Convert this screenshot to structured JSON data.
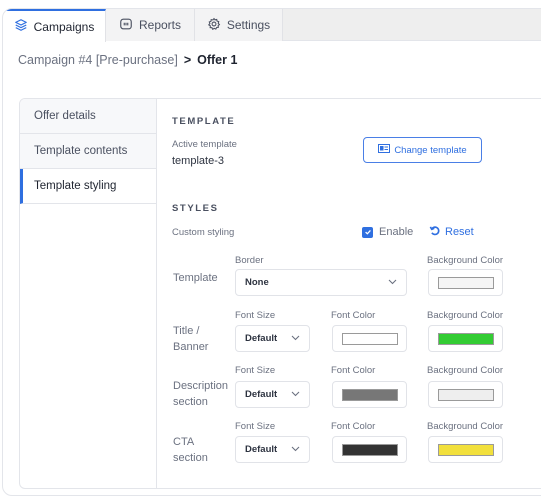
{
  "tabs": [
    {
      "label": "Campaigns",
      "icon": "layers-icon",
      "active": true
    },
    {
      "label": "Reports",
      "icon": "reports-icon",
      "active": false
    },
    {
      "label": "Settings",
      "icon": "gear-icon",
      "active": false
    }
  ],
  "breadcrumb": {
    "parent": "Campaign #4 [Pre-purchase]",
    "separator": ">",
    "current": "Offer 1"
  },
  "sidebar": {
    "items": [
      {
        "label": "Offer details",
        "active": false
      },
      {
        "label": "Template contents",
        "active": false
      },
      {
        "label": "Template styling",
        "active": true
      }
    ]
  },
  "template_section": {
    "title": "TEMPLATE",
    "active_template_label": "Active template",
    "active_template_value": "template-3",
    "change_button_label": "Change template"
  },
  "styles_section": {
    "title": "STYLES",
    "custom_styling_label": "Custom styling",
    "enable_label": "Enable",
    "enable_checked": true,
    "reset_label": "Reset",
    "rows": [
      {
        "label": "Template",
        "border_label": "Border",
        "border_value": "None",
        "bg_label": "Background Color",
        "bg_color": "#f5f5f5"
      },
      {
        "label": "Title / Banner",
        "font_size_label": "Font Size",
        "font_size_value": "Default",
        "font_color_label": "Font Color",
        "font_color": "#ffffff",
        "bg_label": "Background Color",
        "bg_color": "#33cc33"
      },
      {
        "label": "Description section",
        "font_size_label": "Font Size",
        "font_size_value": "Default",
        "font_color_label": "Font Color",
        "font_color": "#777777",
        "bg_label": "Background Color",
        "bg_color": "#eeeeee"
      },
      {
        "label": "CTA section",
        "font_size_label": "Font Size",
        "font_size_value": "Default",
        "font_color_label": "Font Color",
        "font_color": "#333333",
        "bg_label": "Background Color",
        "bg_color": "#f2e03c"
      }
    ]
  },
  "colors": {
    "accent": "#2f6fe0"
  }
}
